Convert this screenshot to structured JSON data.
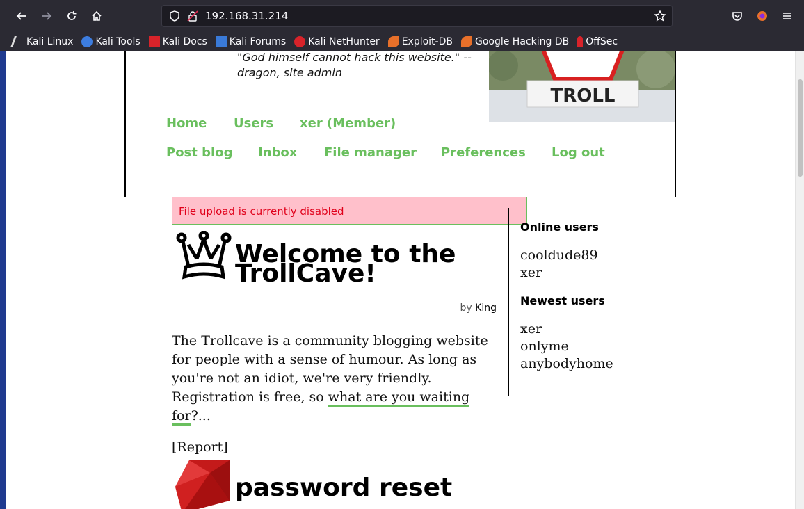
{
  "browser": {
    "url": "192.168.31.214",
    "bookmarks": [
      {
        "label": "Kali Linux",
        "icon": "kali-dragon-icon"
      },
      {
        "label": "Kali Tools",
        "icon": "kali-tools-icon"
      },
      {
        "label": "Kali Docs",
        "icon": "kali-docs-icon"
      },
      {
        "label": "Kali Forums",
        "icon": "kali-forums-icon"
      },
      {
        "label": "Kali NetHunter",
        "icon": "nethunter-icon"
      },
      {
        "label": "Exploit-DB",
        "icon": "exploit-db-icon"
      },
      {
        "label": "Google Hacking DB",
        "icon": "ghdb-icon"
      },
      {
        "label": "OffSec",
        "icon": "offsec-icon"
      }
    ]
  },
  "header": {
    "quote": "\"God himself cannot hack this website.\" -- dragon, site admin",
    "banner_text": "TROLL"
  },
  "nav": {
    "home": "Home",
    "users": "Users",
    "member": "xer (Member)",
    "post_blog": "Post blog",
    "inbox": "Inbox",
    "file_manager": "File manager",
    "preferences": "Preferences",
    "logout": "Log out"
  },
  "alert": {
    "text": "File upload is currently disabled"
  },
  "post1": {
    "title": "Welcome to the TrollCave!",
    "by": "by",
    "author": "King",
    "body_start": "The Trollcave is a community blogging website for people with a sense of humour. As long as you're not an idiot, we're very friendly. Registration is free, so ",
    "body_link": "what are you waiting for",
    "body_end": "?...",
    "report": "[Report]"
  },
  "post2": {
    "title": "password reset"
  },
  "sidebar": {
    "online_heading": "Online users",
    "online_users": [
      "cooldude89",
      "xer"
    ],
    "newest_heading": "Newest users",
    "newest_users": [
      "xer",
      "onlyme",
      "anybodyhome"
    ]
  },
  "colors": {
    "link_green": "#6abf5e",
    "alert_bg": "#ffc0cb",
    "alert_text": "#e0001a",
    "chrome": "#2b2a33"
  }
}
